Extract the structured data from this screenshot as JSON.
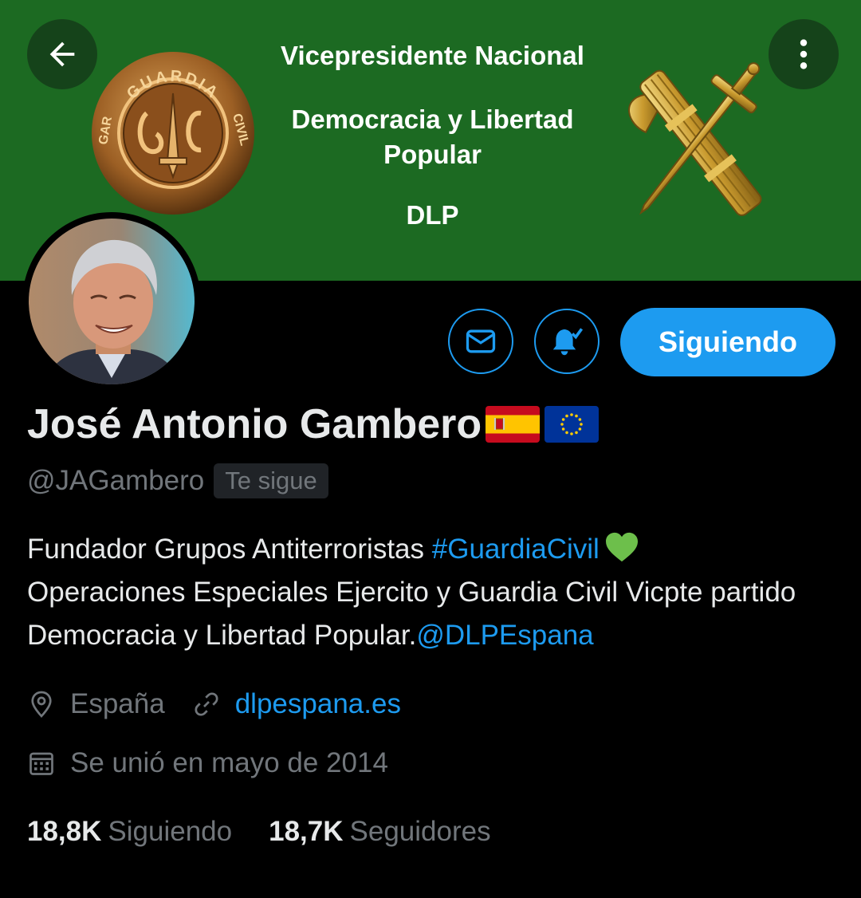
{
  "banner": {
    "line1": "Vicepresidente Nacional",
    "line2": "Democracia y Libertad\nPopular",
    "line3": "DLP",
    "seal_top_text": "GUARDIA",
    "seal_left_text": "GAR",
    "seal_right_text": "CIVIL",
    "bg_color": "#1c6a22"
  },
  "nav": {
    "back_icon": "arrow-left-icon",
    "more_icon": "more-vertical-icon"
  },
  "actions": {
    "message_icon": "envelope-icon",
    "notify_icon": "bell-check-icon",
    "follow_label": "Siguiendo"
  },
  "profile": {
    "name": "José Antonio Gambero",
    "handle": "@JAGambero",
    "follows_you": "Te sigue",
    "bio_part1": "Fundador Grupos Antiterroristas ",
    "bio_hashtag": "#GuardiaCivil",
    "bio_part2": "Operaciones Especiales Ejercito y Guardia Civil   Vicpte partido Democracia y Libertad Popular.",
    "bio_mention": "@DLPEspana",
    "location": "España",
    "website": "dlpespana.es",
    "joined": "Se unió en mayo de 2014"
  },
  "stats": {
    "following_count": "18,8K",
    "following_label": "Siguiendo",
    "followers_count": "18,7K",
    "followers_label": "Seguidores"
  },
  "colors": {
    "accent": "#1d9bf0",
    "text": "#e7e9ea",
    "muted": "#71767b",
    "background": "#000000"
  }
}
